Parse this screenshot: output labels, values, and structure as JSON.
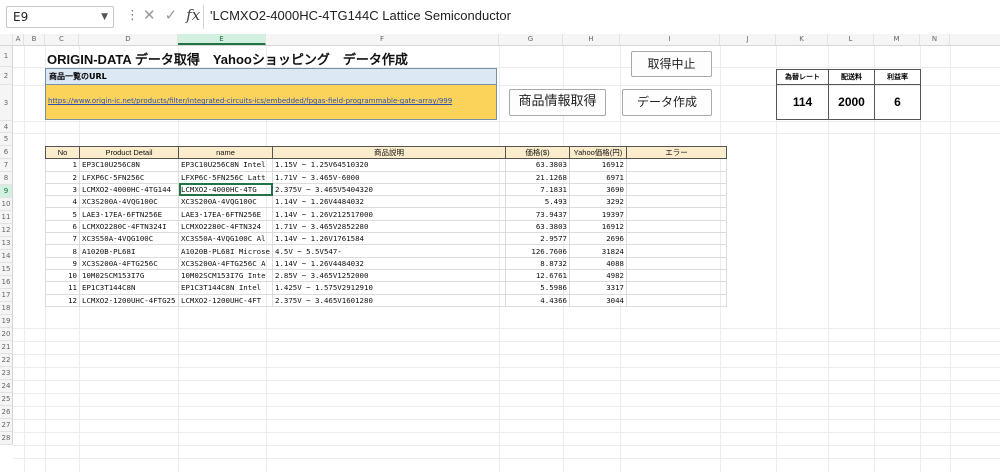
{
  "formula_bar": {
    "name_box": "E9",
    "formula": "'LCMXO2-4000HC-4TG144C Lattice Semiconductor"
  },
  "columns": [
    "A",
    "B",
    "C",
    "D",
    "E",
    "F",
    "G",
    "H",
    "I",
    "J",
    "K",
    "L",
    "M",
    "N"
  ],
  "rows": [
    "1",
    "2",
    "3",
    "4",
    "5",
    "6",
    "7",
    "8",
    "9",
    "10",
    "11",
    "12",
    "13",
    "14",
    "15",
    "16",
    "17",
    "18",
    "19",
    "20",
    "21",
    "22",
    "23",
    "24",
    "25",
    "26",
    "27",
    "28"
  ],
  "sheet": {
    "title": "ORIGIN-DATA データ取得　Yahooショッピング　データ作成",
    "url_label": "商品一覧のURL",
    "url": "https://www.origin-ic.net/products/filter/integrated-circuits-ics/embedded/fpgas-field-programmable-gate-array/999",
    "buttons": {
      "stop": "取得中止",
      "get_product": "商品情報取得",
      "create_data": "データ作成"
    },
    "rates": {
      "headers": [
        "為替レート",
        "配送料",
        "利益率"
      ],
      "values": [
        "114",
        "2000",
        "6"
      ]
    },
    "table": {
      "headers": [
        "No",
        "Product Detail",
        "name",
        "商品説明",
        "価格($)",
        "Yahoo価格(円)",
        "エラー"
      ],
      "rows": [
        [
          "1",
          "EP3C10U256C8N",
          "EP3C10U256C8N Intel",
          "1.15V ~ 1.25V64510320",
          "63.3803",
          "16912",
          ""
        ],
        [
          "2",
          "LFXP6C-5FN256C",
          "LFXP6C-5FN256C Latt",
          "1.71V ~ 3.465V-6000",
          "21.1268",
          "6971",
          ""
        ],
        [
          "3",
          "LCMXO2-4000HC-4TG144",
          "LCMXO2-4000HC-4TG",
          "2.375V ~ 3.465V5404320",
          "7.1831",
          "3690",
          ""
        ],
        [
          "4",
          "XC3S200A-4VQG100C",
          "XC3S200A-4VQG100C",
          "1.14V ~ 1.26V4484032",
          "5.493",
          "3292",
          ""
        ],
        [
          "5",
          "LAE3-17EA-6FTN256E",
          "LAE3-17EA-6FTN256E",
          "1.14V ~ 1.26V212517000",
          "73.9437",
          "19397",
          ""
        ],
        [
          "6",
          "LCMXO2280C-4FTN324I",
          "LCMXO2280C-4FTN324",
          "1.71V ~ 3.465V2852280",
          "63.3803",
          "16912",
          ""
        ],
        [
          "7",
          "XC3S50A-4VQG100C",
          "XC3S50A-4VQG100C Al",
          "1.14V ~ 1.26V1761584",
          "2.9577",
          "2696",
          ""
        ],
        [
          "8",
          "A1020B-PL68I",
          "A1020B-PL68I Microse",
          "4.5V ~ 5.5V547-",
          "126.7606",
          "31824",
          ""
        ],
        [
          "9",
          "XC3S200A-4FTG256C",
          "XC3S200A-4FTG256C A",
          "1.14V ~ 1.26V4484032",
          "8.8732",
          "4088",
          ""
        ],
        [
          "10",
          "10M02SCM153I7G",
          "10M02SCM153I7G Inte",
          "2.85V ~ 3.465V1252000",
          "12.6761",
          "4982",
          ""
        ],
        [
          "11",
          "EP1C3T144C8N",
          "EP1C3T144C8N Intel",
          "1.425V ~ 1.575V2912910",
          "5.5986",
          "3317",
          ""
        ],
        [
          "12",
          "LCMXO2-1200UHC-4FTG25",
          "LCMXO2-1200UHC-4FT",
          "2.375V ~ 3.465V1601280",
          "4.4366",
          "3044",
          ""
        ]
      ]
    }
  }
}
